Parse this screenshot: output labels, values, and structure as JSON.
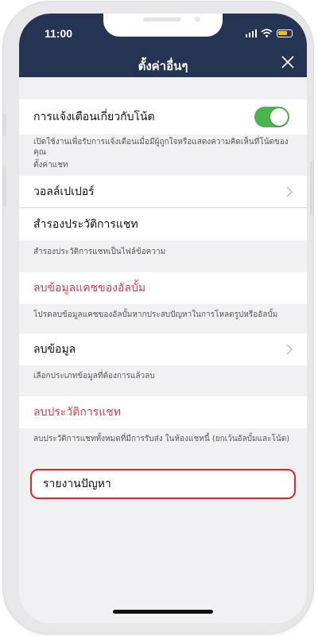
{
  "status_bar": {
    "time": "11:00",
    "battery_color": "#f2c100"
  },
  "header": {
    "title": "ตั้งค่าอื่นๆ",
    "close_icon": "close-icon"
  },
  "notifications": {
    "label": "การแจ้งเตือนเกี่ยวกับโน้ต",
    "toggle_on": true,
    "toggle_color": "#4cb34e",
    "description": "เปิดใช้งานเพื่อรับการแจ้งเตือนเมื่อมีผู้ถูกใจหรือแสดงความคิดเห็นที่โน้ตของคุณ"
  },
  "chat_settings": {
    "section_label": "ตั้งค่าแชท",
    "wallpaper_label": "วอลล์เปเปอร์",
    "backup_label": "สำรองประวัติการแชท",
    "backup_note": "สำรองประวัติการแชทเป็นไฟล์ข้อความ"
  },
  "album_cache": {
    "label": "ลบข้อมูลแคชของอัลบั้ม",
    "note": "โปรดลบข้อมูลแคชของอัลบั้มหากประสบปัญหาในการโหลดรูปหรืออัลบั้ม"
  },
  "delete_data": {
    "label": "ลบข้อมูล",
    "note": "เลือกประเภทข้อมูลที่ต้องการแล้วลบ"
  },
  "delete_history": {
    "label": "ลบประวัติการแชท",
    "note": "ลบประวัติการแชททั้งหมดที่มีการรับส่ง ในห้องแชทนี้ (ยกเว้นอัลบั้มและโน้ต)"
  },
  "report": {
    "label": "รายงานปัญหา",
    "highlight_color": "#e0242a"
  },
  "colors": {
    "navbar": "#243452",
    "destructive_text": "#d73a4e",
    "background": "#f1f1f3"
  }
}
